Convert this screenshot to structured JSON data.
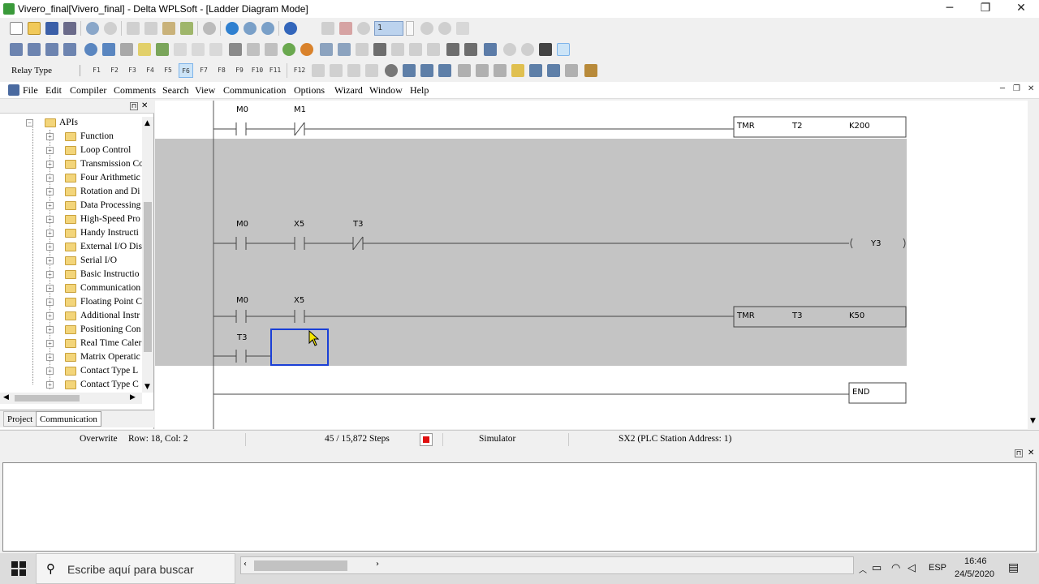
{
  "window": {
    "title": "Vivero_final[Vivero_final] - Delta WPLSoft - [Ladder Diagram Mode]",
    "controls": {
      "minimize": "─",
      "restore": "❐",
      "close": "✕"
    }
  },
  "toolbar2": {
    "station_value": "1"
  },
  "toolbar3": {
    "relay_type": "Relay Type",
    "fkeys": [
      "F1",
      "F2",
      "F3",
      "F4",
      "F5",
      "F6",
      "F7",
      "F8",
      "F9",
      "F10",
      "F11",
      "F12"
    ]
  },
  "menubar": {
    "items": [
      "File",
      "Edit",
      "Compiler",
      "Comments",
      "Search",
      "View",
      "Communication",
      "Options",
      "Wizard",
      "Window",
      "Help"
    ]
  },
  "tree": {
    "root": "APIs",
    "items": [
      "Function",
      "Loop Control",
      "Transmission Co",
      "Four Arithmetic",
      "Rotation and Di",
      "Data Processing",
      "High-Speed Pro",
      "Handy Instructi",
      "External I/O Dis",
      "Serial I/O",
      "Basic Instructio",
      "Communication",
      "Floating Point C",
      "Additional Instr",
      "Positioning Con",
      "Real Time Caler",
      "Matrix Operatic",
      "Contact Type L",
      "Contact Type C"
    ]
  },
  "left_tabs": {
    "project": "Project",
    "communication": "Communication"
  },
  "ladder": {
    "rung1": {
      "c1": "M0",
      "c2": "M1",
      "box_fn": "TMR",
      "box_dev": "T2",
      "box_k": "K200"
    },
    "rung2": {
      "c1": "M0",
      "c2": "X5",
      "c3": "T3",
      "coil": "Y3"
    },
    "rung3": {
      "c1": "M0",
      "c2": "X5",
      "c3": "T3",
      "box_fn": "TMR",
      "box_dev": "T3",
      "box_k": "K50"
    },
    "end": "END"
  },
  "statusbar": {
    "mode": "Overwrite",
    "position": "Row: 18, Col: 2",
    "steps": "45 / 15,872 Steps",
    "sim": "Simulator",
    "station": "SX2 (PLC Station Address: 1)"
  },
  "taskbar": {
    "search_placeholder": "Escribe aquí para buscar",
    "lang": "ESP",
    "time": "16:46",
    "date": "24/5/2020"
  }
}
